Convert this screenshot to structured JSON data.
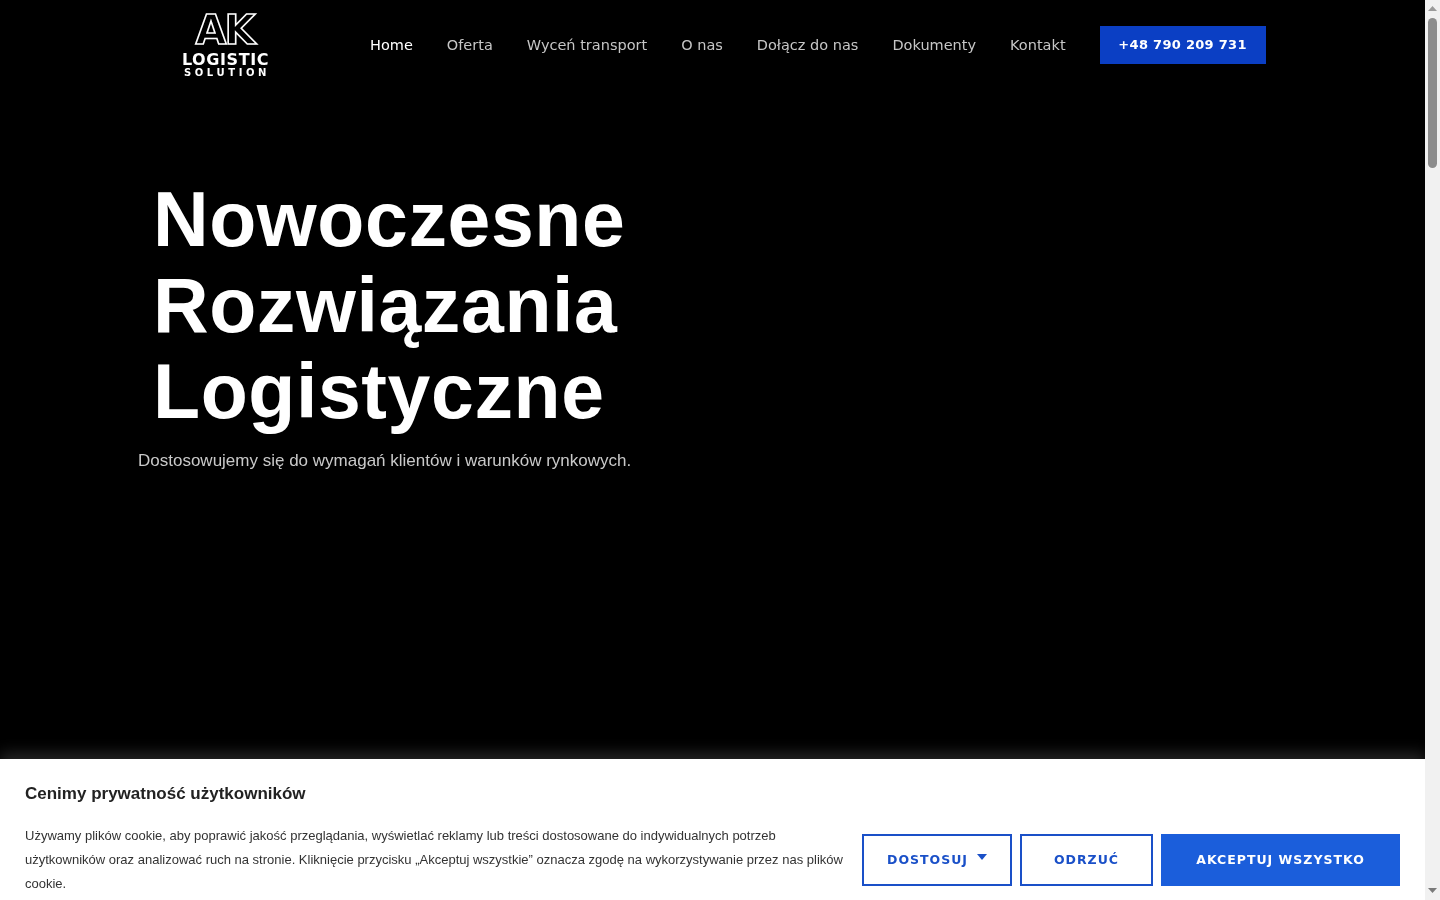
{
  "header": {
    "logo": {
      "mark": "AK",
      "line_1": "LOGISTIC",
      "line_2": "SOLUTION"
    },
    "nav": [
      {
        "label": "Home",
        "selected": true
      },
      {
        "label": "Oferta",
        "selected": false
      },
      {
        "label": "Wyceń transport",
        "selected": false
      },
      {
        "label": "O nas",
        "selected": false
      },
      {
        "label": "Dołącz do nas",
        "selected": false
      },
      {
        "label": "Dokumenty",
        "selected": false
      },
      {
        "label": "Kontakt",
        "selected": false
      }
    ],
    "phone_button": "+48 790 209 731"
  },
  "hero": {
    "title": "Nowoczesne Rozwiązania Logistyczne",
    "subtitle": "Dostosowujemy się do wymagań klientów i warunków rynkowych."
  },
  "cookie_banner": {
    "title": "Cenimy prywatność użytkowników",
    "text": "Używamy plików cookie, aby poprawić jakość przeglądania, wyświetlać reklamy lub treści dostosowane do indywidualnych potrzeb użytkowników oraz analizować ruch na stronie. Kliknięcie przycisku „Akceptuj wszystkie” oznacza zgodę na wykorzystywanie przez nas plików cookie.",
    "buttons": [
      {
        "label": "DOSTOSUJ",
        "kind": "dropdown"
      },
      {
        "label": "ODRZUĆ",
        "kind": "outline"
      },
      {
        "label": "AKCEPTUJ WSZYSTKO",
        "kind": "primary"
      }
    ]
  }
}
